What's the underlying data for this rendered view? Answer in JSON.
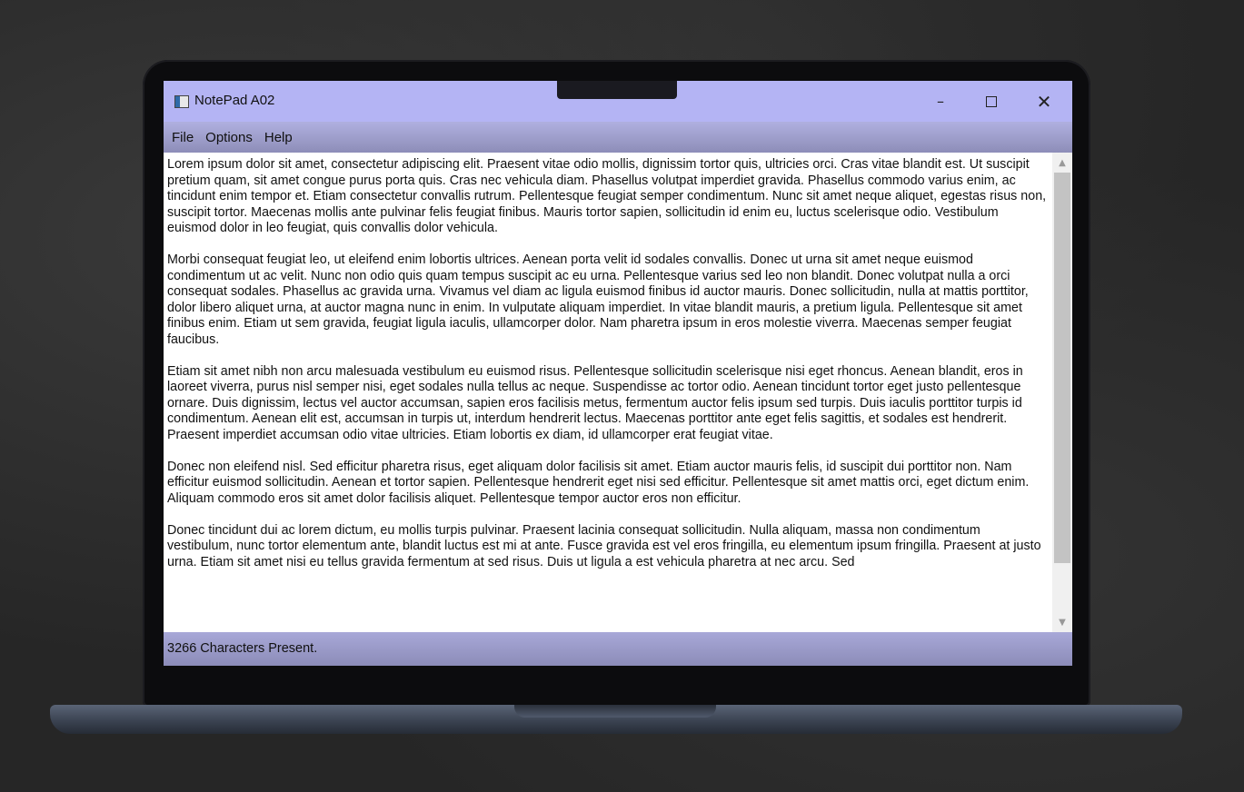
{
  "window": {
    "title": "NotePad A02",
    "controls": {
      "minimize": "–",
      "close": "✕"
    }
  },
  "menu": {
    "items": [
      "File",
      "Options",
      "Help"
    ]
  },
  "editor": {
    "paragraphs": [
      "Lorem ipsum dolor sit amet, consectetur adipiscing elit. Praesent vitae odio mollis, dignissim tortor quis, ultricies orci. Cras vitae blandit est. Ut suscipit pretium quam, sit amet congue purus porta quis. Cras nec vehicula diam. Phasellus volutpat imperdiet gravida. Phasellus commodo varius enim, ac tincidunt enim tempor et. Etiam consectetur convallis rutrum. Pellentesque feugiat semper condimentum. Nunc sit amet neque aliquet, egestas risus non, suscipit tortor. Maecenas mollis ante pulvinar felis feugiat finibus. Mauris tortor sapien, sollicitudin id enim eu, luctus scelerisque odio. Vestibulum euismod dolor in leo feugiat, quis convallis dolor vehicula.",
      "Morbi consequat feugiat leo, ut eleifend enim lobortis ultrices. Aenean porta velit id sodales convallis. Donec ut urna sit amet neque euismod condimentum ut ac velit. Nunc non odio quis quam tempus suscipit ac eu urna. Pellentesque varius sed leo non blandit. Donec volutpat nulla a orci consequat sodales. Phasellus ac gravida urna. Vivamus vel diam ac ligula euismod finibus id auctor mauris. Donec sollicitudin, nulla at mattis porttitor, dolor libero aliquet urna, at auctor magna nunc in enim. In vulputate aliquam imperdiet. In vitae blandit mauris, a pretium ligula. Pellentesque sit amet finibus enim. Etiam ut sem gravida, feugiat ligula iaculis, ullamcorper dolor. Nam pharetra ipsum in eros molestie viverra. Maecenas semper feugiat faucibus.",
      "Etiam sit amet nibh non arcu malesuada vestibulum eu euismod risus. Pellentesque sollicitudin scelerisque nisi eget rhoncus. Aenean blandit, eros in laoreet viverra, purus nisl semper nisi, eget sodales nulla tellus ac neque. Suspendisse ac tortor odio. Aenean tincidunt tortor eget justo pellentesque ornare. Duis dignissim, lectus vel auctor accumsan, sapien eros facilisis metus, fermentum auctor felis ipsum sed turpis. Duis iaculis porttitor turpis id condimentum. Aenean elit est, accumsan in turpis ut, interdum hendrerit lectus. Maecenas porttitor ante eget felis sagittis, et sodales est hendrerit. Praesent imperdiet accumsan odio vitae ultricies. Etiam lobortis ex diam, id ullamcorper erat feugiat vitae.",
      "Donec non eleifend nisl. Sed efficitur pharetra risus, eget aliquam dolor facilisis sit amet. Etiam auctor mauris felis, id suscipit dui porttitor non. Nam efficitur euismod sollicitudin. Aenean et tortor sapien. Pellentesque hendrerit eget nisi sed efficitur. Pellentesque sit amet mattis orci, eget dictum enim. Aliquam commodo eros sit amet dolor facilisis aliquet. Pellentesque tempor auctor eros non efficitur.",
      "Donec tincidunt dui ac lorem dictum, eu mollis turpis pulvinar. Praesent lacinia consequat sollicitudin. Nulla aliquam, massa non condimentum vestibulum, nunc tortor elementum ante, blandit luctus est mi at ante. Fusce gravida est vel eros fringilla, eu elementum ipsum fringilla. Praesent at justo urna. Etiam sit amet nisi eu tellus gravida fermentum at sed risus. Duis ut ligula a est vehicula pharetra at nec arcu. Sed"
    ]
  },
  "scrollbar": {
    "up_icon": "chevron-up-icon",
    "down_icon": "chevron-down-icon"
  },
  "status": {
    "text": "3266 Characters Present."
  },
  "colors": {
    "titlebar": "#b4b4f4",
    "menubar": "#9c9cc8",
    "statusbar": "#9a9ac8",
    "background": "#262626"
  }
}
